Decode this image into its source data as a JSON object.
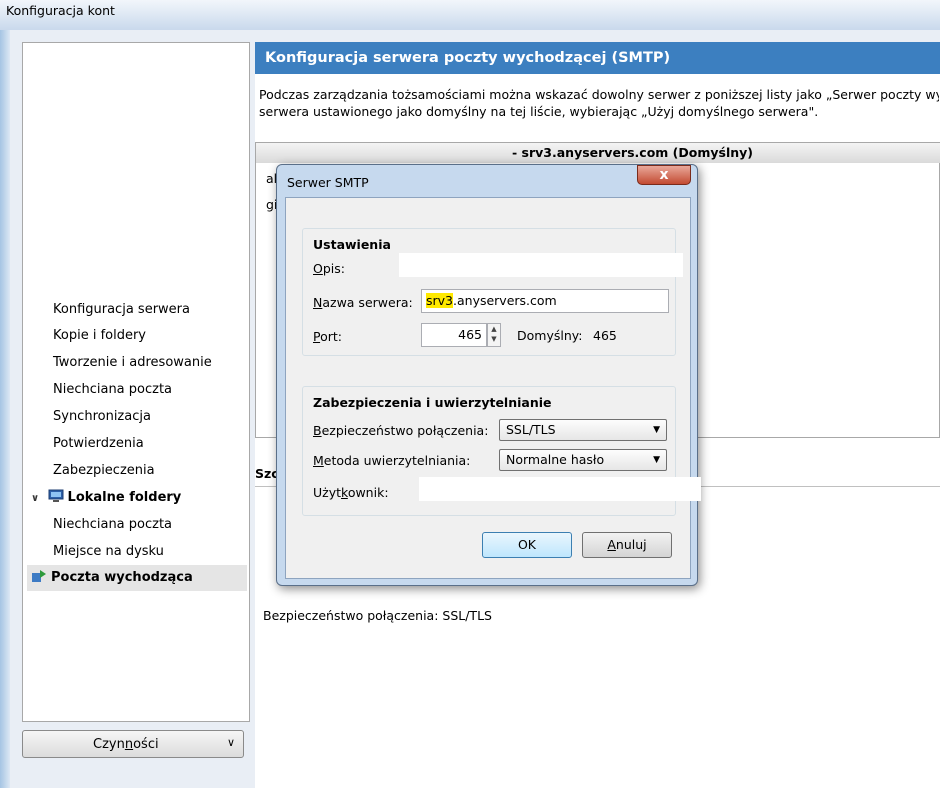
{
  "window": {
    "title": "Konfiguracja kont"
  },
  "sidebar": {
    "items": [
      {
        "label": "Konfiguracja serwera"
      },
      {
        "label": "Kopie i foldery"
      },
      {
        "label": "Tworzenie i adresowanie"
      },
      {
        "label": "Niechciana poczta"
      },
      {
        "label": "Synchronizacja"
      },
      {
        "label": "Potwierdzenia"
      },
      {
        "label": "Zabezpieczenia"
      }
    ],
    "local_folders": {
      "label": "Lokalne foldery",
      "items": [
        {
          "label": "Niechciana poczta"
        },
        {
          "label": "Miejsce na dysku"
        }
      ]
    },
    "outgoing": {
      "label": "Poczta wychodząca"
    },
    "actions_label_pre": "Czyn",
    "actions_label_u": "n",
    "actions_label_post": "ości"
  },
  "main": {
    "header": "Konfiguracja serwera poczty wychodzącej (SMTP)",
    "description_line1": "Podczas zarządzania tożsamościami można wskazać dowolny serwer z poniższej listy jako „Serwer poczty wy",
    "description_line2": "serwera ustawionego jako domyślny na tej liście, wybierając „Użyj domyślnego serwera\".",
    "server_list_header": "- srv3.anyservers.com (Domyślny)",
    "peek_row1": "al",
    "peek_row2": "gi",
    "details_heading": "Szc",
    "details_line": "Bezpieczeństwo połączenia:  SSL/TLS"
  },
  "dialog": {
    "title": "Serwer SMTP",
    "close_glyph": "x",
    "settings": {
      "title": "Ustawienia",
      "desc_label_u": "O",
      "desc_label_rest": "pis:",
      "desc_value": "",
      "server_label_u": "N",
      "server_label_rest": "azwa serwera:",
      "server_value_hl": "srv3",
      "server_value_rest": ".anyservers.com",
      "port_label_u": "P",
      "port_label_rest": "ort:",
      "port_value": "465",
      "default_label": "Domyślny:",
      "default_value": "465"
    },
    "security": {
      "title": "Zabezpieczenia i uwierzytelnianie",
      "conn_label_u": "B",
      "conn_label_rest": "ezpieczeństwo połączenia:",
      "conn_value": "SSL/TLS",
      "auth_label_u": "M",
      "auth_label_rest": "etoda uwierzytelniania:",
      "auth_value": "Normalne hasło",
      "user_label_pre": "Użyt",
      "user_label_u": "k",
      "user_label_post": "ownik:",
      "user_value": ""
    },
    "ok_label": "OK",
    "cancel_label_u": "A",
    "cancel_label_rest": "nuluj"
  },
  "colors": {
    "header_blue": "#3c7fc0",
    "highlight": "#ffe900"
  }
}
